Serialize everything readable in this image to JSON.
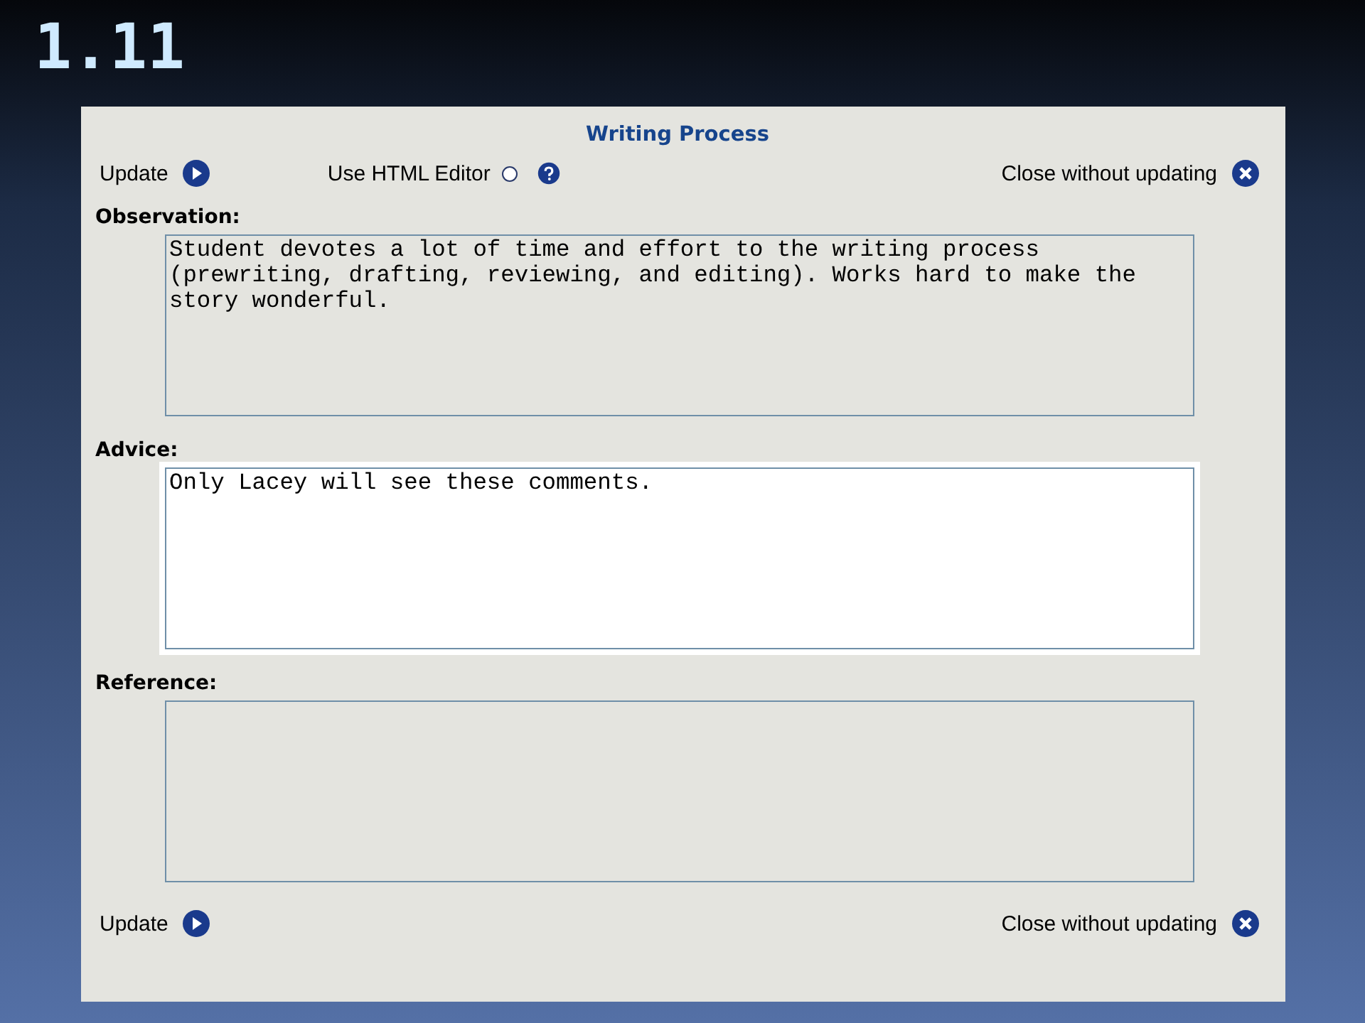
{
  "slide_title": "1.11",
  "window": {
    "title": "Writing Process"
  },
  "toolbar": {
    "update": "Update",
    "html_editor": {
      "label": "Use HTML Editor",
      "checked": false
    },
    "close": "Close without updating"
  },
  "fields": [
    {
      "label": "Observation:",
      "value": "Student devotes a lot of time and effort to the writing process (prewriting, drafting, reviewing, and editing). Works hard to make the story wonderful.",
      "focused": false
    },
    {
      "label": "Advice:",
      "value": "Only Lacey will see these comments.",
      "focused": true
    },
    {
      "label": "Reference:",
      "focused": false
    }
  ],
  "footer": {
    "update": "Update",
    "close": "Close without updating"
  }
}
